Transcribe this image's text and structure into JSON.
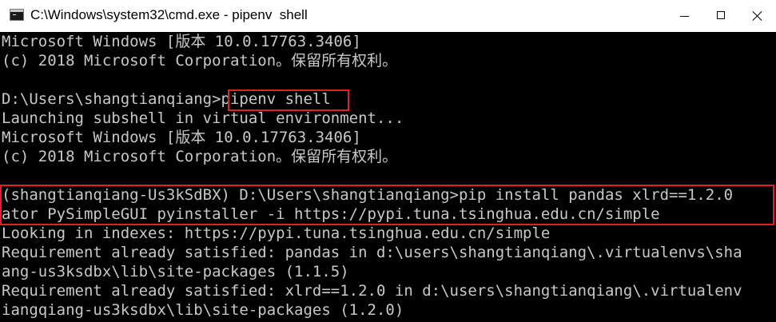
{
  "window": {
    "title": "C:\\Windows\\system32\\cmd.exe - pipenv  shell"
  },
  "console": {
    "lines": [
      "Microsoft Windows [版本 10.0.17763.3406]",
      "(c) 2018 Microsoft Corporation。保留所有权利。",
      "",
      "D:\\Users\\shangtianqiang>pipenv shell",
      "Launching subshell in virtual environment...",
      "Microsoft Windows [版本 10.0.17763.3406]",
      "(c) 2018 Microsoft Corporation。保留所有权利。",
      "",
      "(shangtianqiang-Us3kSdBX) D:\\Users\\shangtianqiang>pip install pandas xlrd==1.2.0",
      "ator PySimpleGUI pyinstaller -i https://pypi.tuna.tsinghua.edu.cn/simple",
      "Looking in indexes: https://pypi.tuna.tsinghua.edu.cn/simple",
      "Requirement already satisfied: pandas in d:\\users\\shangtianqiang\\.virtualenvs\\sha",
      "ang-us3ksdbx\\lib\\site-packages (1.1.5)",
      "Requirement already satisfied: xlrd==1.2.0 in d:\\users\\shangtianqiang\\.virtualenv",
      "iangqiang-us3ksdbx\\lib\\site-packages (1.2.0)"
    ]
  },
  "colors": {
    "console_bg": "#000000",
    "console_text": "#c8c8c8",
    "highlight": "#e0202a"
  }
}
